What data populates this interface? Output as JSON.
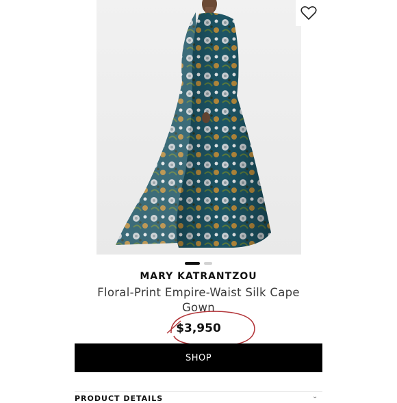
{
  "product": {
    "brand": "MARY KATRANTZOU",
    "title": "Floral-Print Empire-Waist Silk Cape Gown",
    "price": "$3,950",
    "image_icon": "product-photo",
    "wishlist_icon": "heart-icon"
  },
  "carousel": {
    "active_index": 0,
    "count": 2
  },
  "actions": {
    "shop_label": "SHOP"
  },
  "sections": {
    "details_label": "PRODUCT DETAILS"
  },
  "colors": {
    "price_circle": "#b3363a",
    "button_bg": "#000000",
    "gown_teal": "#1f5a6a"
  }
}
